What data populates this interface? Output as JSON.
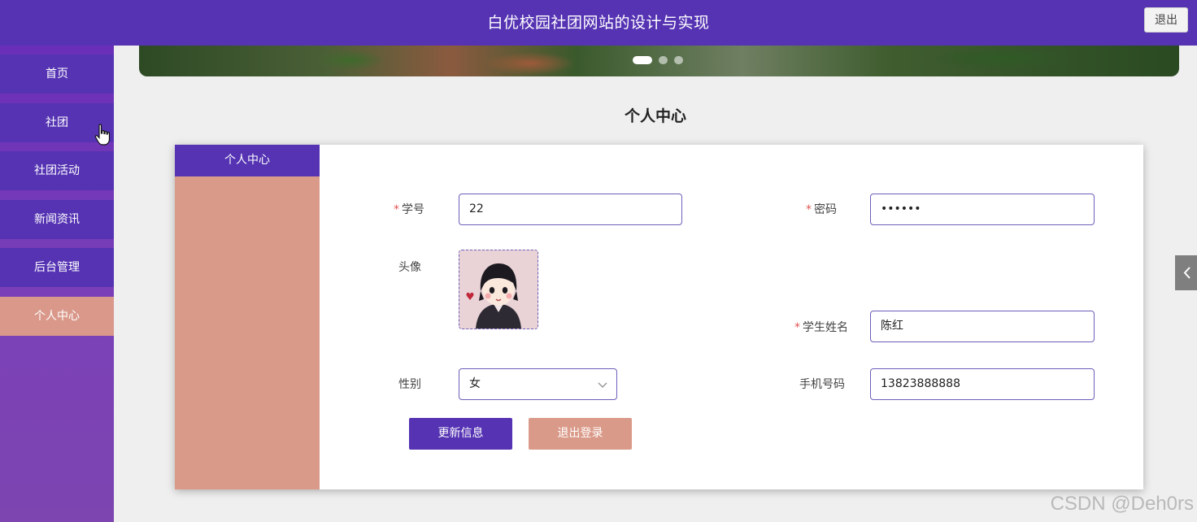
{
  "header": {
    "title": "白优校园社团网站的设计与实现",
    "logout_label": "退出"
  },
  "sidebar": {
    "items": [
      {
        "label": "首页"
      },
      {
        "label": "社团"
      },
      {
        "label": "社团活动"
      },
      {
        "label": "新闻资讯"
      },
      {
        "label": "后台管理"
      },
      {
        "label": "个人中心",
        "active": true
      }
    ]
  },
  "banner": {
    "slide_count": 3,
    "active_slide": 1
  },
  "page": {
    "heading": "个人中心"
  },
  "card": {
    "side_tab_label": "个人中心"
  },
  "form": {
    "student_id": {
      "label": "学号",
      "required": true,
      "value": "22"
    },
    "password": {
      "label": "密码",
      "required": true,
      "value": "••••••"
    },
    "avatar": {
      "label": "头像"
    },
    "student_name": {
      "label": "学生姓名",
      "required": true,
      "value": "陈红"
    },
    "gender": {
      "label": "性别",
      "value": "女"
    },
    "phone": {
      "label": "手机号码",
      "value": "13823888888"
    },
    "required_mark": "*"
  },
  "actions": {
    "update_label": "更新信息",
    "logout_label": "退出登录"
  },
  "watermark": "CSDN @Deh0rs",
  "colors": {
    "primary": "#5533b3",
    "accent": "#da9a89",
    "required": "#e05555"
  }
}
